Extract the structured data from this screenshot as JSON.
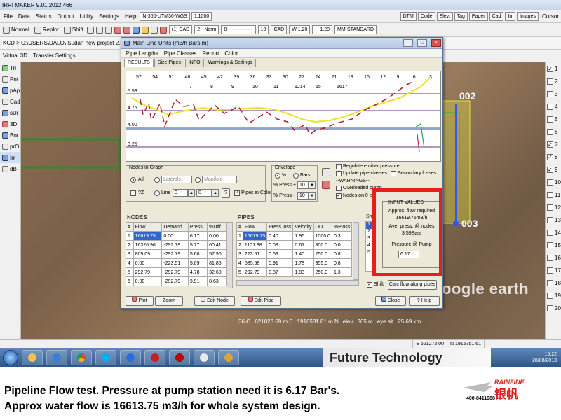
{
  "app": {
    "title": "IRRI MAKER  9.01   2012:466",
    "menu": [
      "File",
      "Data",
      "Status",
      "Output",
      "Utility",
      "Settings",
      "Help"
    ],
    "projection": "N-360-UTM36-WGS",
    "scale": "1:1000",
    "menu_right": [
      "DTM",
      "Code",
      "Elev.",
      "Tag",
      "Paper",
      "Cad",
      "Irr",
      "Images",
      "Cursor"
    ],
    "toolbar2": [
      "Normal",
      "Replot",
      "Shift"
    ],
    "cad_selector": "(1) CAD",
    "norm_selector": "2 - Norm",
    "dash_selector": "0----------------",
    "size": "10",
    "cad_label": "CAD",
    "w": "W 1.20",
    "h": "H 1.20",
    "std": "MM-STANDARD",
    "path": "KCD > C:\\USERS\\DALO\\ Sudan new project 2.mal",
    "subbar": [
      "Virtual 3D",
      "Transfer Settings"
    ],
    "left_tools": [
      "Tri",
      "Pnt",
      "pAp",
      "Cad",
      "sUr",
      "3D",
      "Bor",
      "prO",
      "Irr",
      "dB"
    ],
    "layers": [
      "1",
      "2",
      "3",
      "4",
      "5",
      "6",
      "7",
      "8",
      "9",
      "10",
      "11",
      "12",
      "13",
      "14",
      "15",
      "16",
      "17",
      "18",
      "19",
      "20"
    ]
  },
  "map": {
    "node_labels": [
      "002",
      "003"
    ],
    "status": [
      "36 O",
      "621028.69 m E",
      "1916581.81 m N",
      "elev",
      "365 m",
      "eye alt",
      "25.69 km"
    ],
    "logo": "oogle earth"
  },
  "statusbar": {
    "e": "E 621272.00",
    "n": "N 1915751.61"
  },
  "taskbar": {
    "banner": "Future Technology",
    "time": "15:22",
    "date": "28/08/2013"
  },
  "dialog": {
    "title": "Main Line  Units (m3/h  Bars  m)",
    "menu": [
      "Pipe Lengths",
      "Pipe Classes",
      "Report",
      "Color"
    ],
    "tabs": [
      "RESULTS",
      "Size Pipes",
      "INFO",
      "Warnings & Settings"
    ],
    "graph_top_labels": [
      "57",
      "54",
      "51",
      "48",
      "45",
      "42",
      "39",
      "36",
      "33",
      "30",
      "27",
      "24",
      "21",
      "18",
      "15",
      "12",
      "9",
      "6",
      "3"
    ],
    "graph_mid_labels": [
      "7",
      "8",
      "9",
      "10",
      "11",
      "1214",
      "15",
      "1617"
    ],
    "graph_y_labels": [
      "5.58",
      "4.75",
      "4.00",
      "3.25"
    ],
    "nodes_in_graph": {
      "title": "Nodes in Graph",
      "all": "All",
      "laterals": "Laterals",
      "manifold": "Manifold",
      "pz": "?Z",
      "line": "Line",
      "from": "0",
      "to": "0",
      "q": "?",
      "pipes_in_color": "Pipes in Color"
    },
    "envelope": {
      "title": "Envelope",
      "pct": "%",
      "bars": "Bars",
      "press_plus_lbl": "% Press +",
      "press_plus": "10",
      "press_minus_lbl": "% Press -",
      "press_minus": "10"
    },
    "options": {
      "regulate": "Regulate emitter pressure",
      "update_classes": "Update pipe classes",
      "secondary": "Secondary losses",
      "warnings": "--WARNINGS--",
      "overloaded": "Overloaded pump",
      "nodes_on": "Nodes on 0 el"
    },
    "nodes_table": {
      "title": "NODES",
      "headers": [
        "#",
        "Flow",
        "Demand",
        "Press",
        "%Diff"
      ],
      "rows": [
        [
          "1",
          "16619.75",
          "0.00",
          "6.17",
          "0.00"
        ],
        [
          "2",
          "16326.96",
          "-292.79",
          "5.77",
          "60.41"
        ],
        [
          "3",
          "809.09",
          "-292.79",
          "5.68",
          "57.90"
        ],
        [
          "4",
          "0.00",
          "-223.51",
          "5.09",
          "81.85"
        ],
        [
          "5",
          "292.79",
          "-292.79",
          "4.78",
          "32.68"
        ],
        [
          "6",
          "0.00",
          "-292.79",
          "3.91",
          "8.63"
        ]
      ]
    },
    "pipes_table": {
      "title": "PIPES",
      "headers": [
        "#",
        "Flow",
        "Press loss",
        "Velocity",
        "OD",
        "%Ploss"
      ],
      "rows": [
        [
          "1",
          "16619.75",
          "0.40",
          "1.96",
          "1000.0",
          "0.3"
        ],
        [
          "2",
          "1101.88",
          "0.09",
          "0.61",
          "800.0",
          "0.0"
        ],
        [
          "3",
          "223.51",
          "0.59",
          "1.40",
          "250.0",
          "0.8"
        ],
        [
          "4",
          "585.58",
          "0.91",
          "1.78",
          "355.0",
          "0.8"
        ],
        [
          "5",
          "292.79",
          "0.87",
          "1.83",
          "250.0",
          "1.3"
        ]
      ]
    },
    "shift": {
      "title": "Shift",
      "items": [
        "1",
        "2",
        "3",
        "4",
        "5"
      ],
      "check": "Shift",
      "calc": "Calc flow along pipes"
    },
    "input_values": {
      "title": "INPUT VALUES",
      "approx_label": "Approx. flow required",
      "approx_value": "16619.75m3/h",
      "avg_label": "Ave. press. @ nodes",
      "avg_value": "3.59Bars",
      "pump_label": "Pressure @ Pump",
      "pump_value": "6.17"
    },
    "bottom": [
      "Plot",
      "Zoom",
      "Edit Node",
      "Edit Pipe",
      "Close",
      "Help"
    ]
  },
  "caption": {
    "line1": "Pipeline Flow test. Pressure at pump station need it is 6.17 Bar's.",
    "line2": "Approx water flow is 16613.75 m3/h for whole system design."
  },
  "brand": {
    "name": "RAINFINE",
    "cn": "银帆",
    "phone": "400-8411988"
  }
}
